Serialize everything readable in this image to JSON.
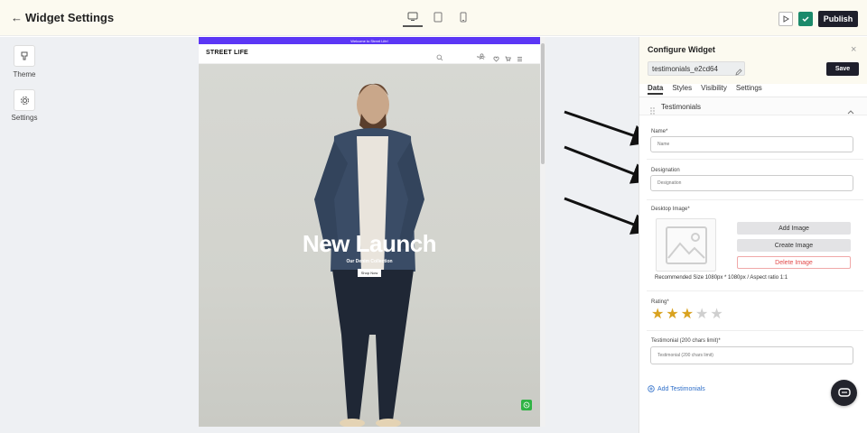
{
  "header": {
    "back_glyph": "←",
    "title": "Widget Settings",
    "publish_label": "Publish"
  },
  "left_rail": {
    "items": [
      {
        "label": "Theme",
        "icon": "brush-icon"
      },
      {
        "label": "Settings",
        "icon": "gear-icon"
      }
    ]
  },
  "preview": {
    "announcement": "Welcome to Street Life!",
    "logo": "STREET LIFE",
    "sign_in": "Sign In",
    "hero_title": "New Launch",
    "hero_subtitle": "Our Denim Collection",
    "shop_button": "Shop Now"
  },
  "panel": {
    "title": "Configure Widget",
    "close_glyph": "×",
    "widget_id": "testimonials_e2cd64",
    "save_label": "Save",
    "tabs": [
      "Data",
      "Styles",
      "Visibility",
      "Settings"
    ],
    "section_label": "Testimonials",
    "name_label": "Name*",
    "name_placeholder": "Name",
    "designation_label": "Designation",
    "designation_placeholder": "Designation",
    "desktop_image_label": "Desktop Image*",
    "add_image": "Add Image",
    "create_image": "Create Image",
    "delete_image": "Delete Image",
    "recommend": "Recommended Size 1080px * 1080px / Aspect ratio 1:1",
    "rating_label": "Rating*",
    "rating_value": 3,
    "rating_max": 5,
    "testimonial_label": "Testimonial (200 chars limit)*",
    "testimonial_placeholder": "Testimonial (200 chars limit)",
    "add_testimonials": "Add Testimonials"
  },
  "colors": {
    "accent_dark": "#1e1f2b",
    "announcement_bar": "#5b36f5",
    "star": "#d9a21f",
    "link": "#2f6fc9",
    "danger": "#e24b4b"
  }
}
